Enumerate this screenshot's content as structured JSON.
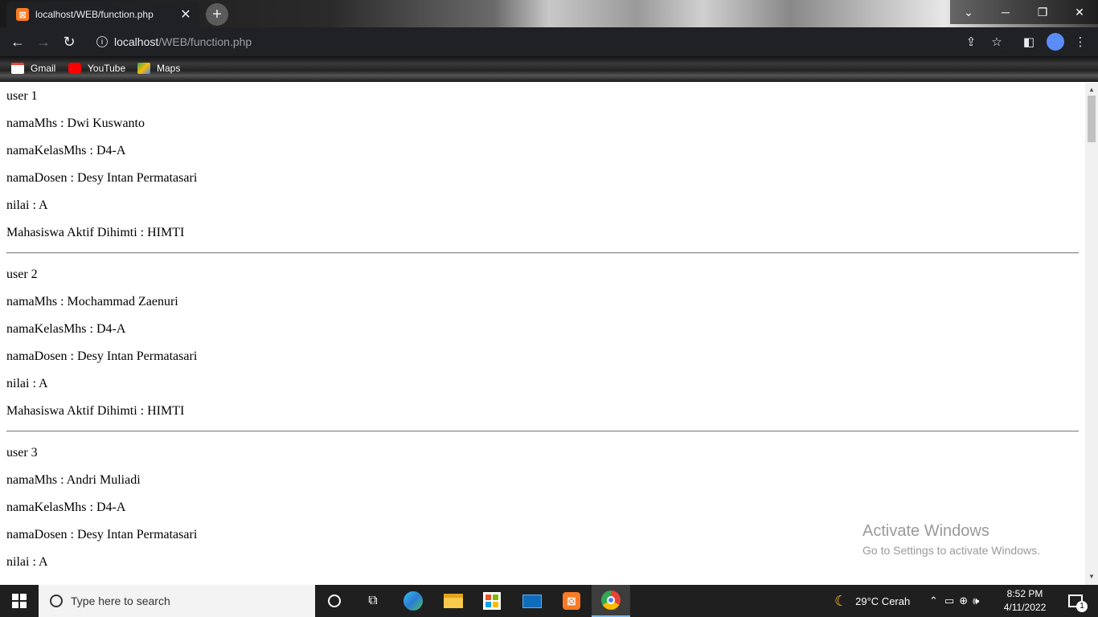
{
  "browser": {
    "tab_title": "localhost/WEB/function.php",
    "favicon_letter": "⊠",
    "url_host": "localhost",
    "url_path": "/WEB/function.php",
    "bookmarks": [
      "Gmail",
      "YouTube",
      "Maps"
    ]
  },
  "users": [
    {
      "heading": "user 1",
      "fields": [
        "namaMhs : Dwi Kuswanto",
        "namaKelasMhs : D4-A",
        "namaDosen : Desy Intan Permatasari",
        "nilai : A",
        "Mahasiswa Aktif Dihimti : HIMTI"
      ]
    },
    {
      "heading": "user 2",
      "fields": [
        "namaMhs : Mochammad Zaenuri",
        "namaKelasMhs : D4-A",
        "namaDosen : Desy Intan Permatasari",
        "nilai : A",
        "Mahasiswa Aktif Dihimti : HIMTI"
      ]
    },
    {
      "heading": "user 3",
      "fields": [
        "namaMhs : Andri Muliadi",
        "namaKelasMhs : D4-A",
        "namaDosen : Desy Intan Permatasari",
        "nilai : A"
      ]
    }
  ],
  "watermark": {
    "title": "Activate Windows",
    "subtitle": "Go to Settings to activate Windows."
  },
  "taskbar": {
    "search_placeholder": "Type here to search",
    "weather": "29°C  Cerah",
    "time": "8:52 PM",
    "date": "4/11/2022",
    "notification_count": "1"
  },
  "colors": {
    "xampp": "#fb7a24",
    "chrome_dark": "#202124",
    "taskbar": "#1f1f1f"
  }
}
